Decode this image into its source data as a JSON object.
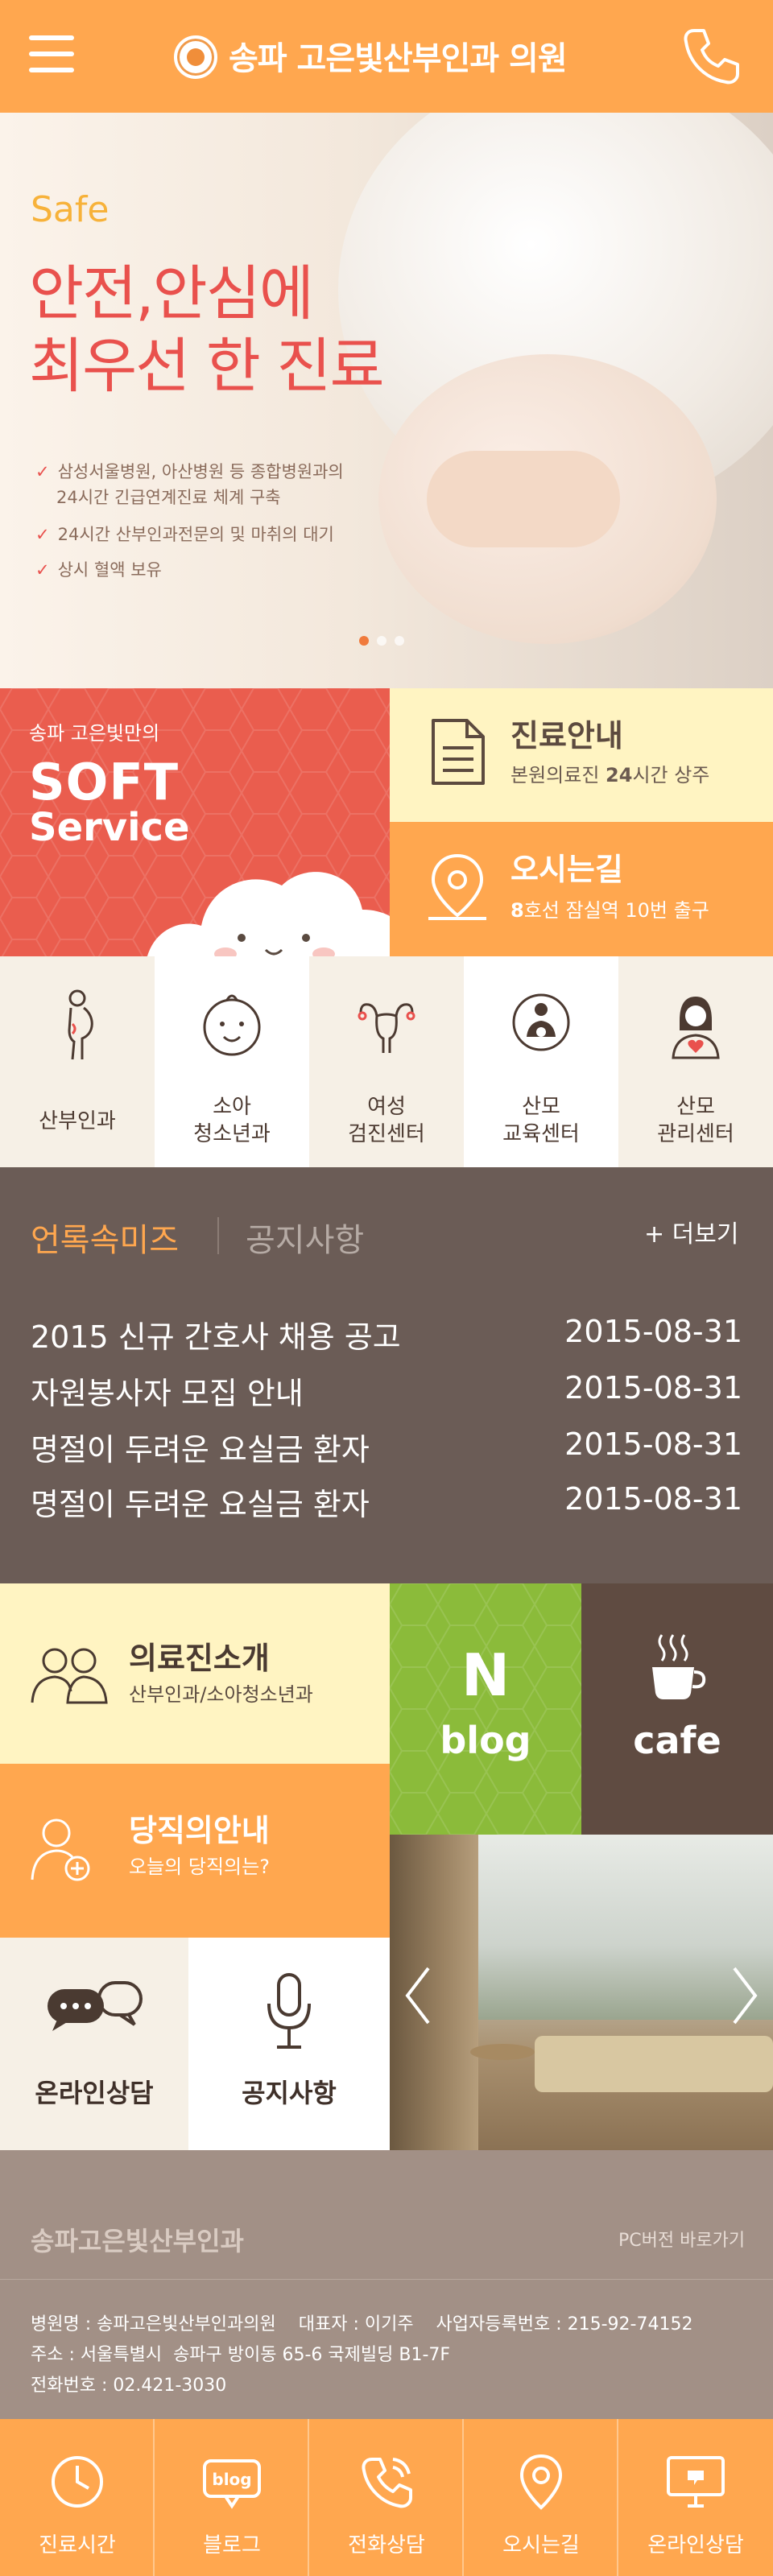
{
  "header": {
    "title": "송파 고은빛산부인과 의원",
    "menu_icon": "hamburger-icon",
    "phone_icon": "phone-icon",
    "logo_icon": "hospital-emblem",
    "brand_color": "#ffa74f"
  },
  "hero": {
    "eyebrow": "Safe",
    "title_line1": "안전,안심에",
    "title_line2": "최우선 한 진료",
    "points": [
      "삼성서울병원, 아산병원 등 종합병원과의",
      "24시간 긴급연계진료 체계 구축",
      "24시간 산부인과전문의 및 마취의 대기",
      "상시 혈액 보유"
    ],
    "slide_count": 3,
    "active_slide": 1,
    "accent": "#e9514d"
  },
  "soft_service": {
    "pre": "송파 고은빛만의",
    "line1": "SOFT",
    "line2": "Service",
    "color": "#ea5d4e"
  },
  "care_info": {
    "title": "진료안내",
    "sub_prefix": "본원의료진 ",
    "sub_bold": "24",
    "sub_suffix": "시간 상주",
    "icon": "document-icon"
  },
  "directions": {
    "title": "오시는길",
    "sub_bold": "8",
    "sub_suffix": "호선 잠실역 10번 출구",
    "icon": "location-pin-icon"
  },
  "centers": [
    {
      "label": "산부인과",
      "icon": "pregnant-woman-icon",
      "bg": "#f6f0e6"
    },
    {
      "label": "소아\n청소년과",
      "icon": "baby-face-icon",
      "bg": "#ffffff"
    },
    {
      "label": "여성\n검진센터",
      "icon": "uterus-icon",
      "bg": "#f6f0e6"
    },
    {
      "label": "산모\n교육센터",
      "icon": "mother-child-icon",
      "bg": "#ffffff"
    },
    {
      "label": "산모\n관리센터",
      "icon": "mother-heart-icon",
      "bg": "#f6f0e6"
    }
  ],
  "notice": {
    "tab_active": "언록속미즈",
    "tab_inactive": "공지사항",
    "more": "+ 더보기",
    "items": [
      {
        "title": "2015 신규 간호사 채용 공고",
        "date": "2015-08-31"
      },
      {
        "title": "자원봉사자 모집 안내",
        "date": "2015-08-31"
      },
      {
        "title": "명절이 두려운 요실금 환자",
        "date": "2015-08-31"
      },
      {
        "title": "명절이 두려운 요실금 환자",
        "date": "2015-08-31"
      }
    ]
  },
  "promos": {
    "doctors": {
      "title": "의료진소개",
      "sub": "산부인과/소아청소년과",
      "icon": "doctors-icon"
    },
    "duty": {
      "title": "당직의안내",
      "sub": "오늘의 당직의는?",
      "icon": "add-user-icon"
    },
    "blog": {
      "logo": "N",
      "label": "blog"
    },
    "cafe": {
      "label": "cafe",
      "icon": "coffee-cup-icon"
    },
    "online": {
      "label": "온라인상담",
      "icon": "chat-bubbles-icon"
    },
    "notice": {
      "label": "공지사항",
      "icon": "microphone-icon"
    },
    "gallery": {
      "prev_icon": "chevron-left-icon",
      "next_icon": "chevron-right-icon"
    }
  },
  "footer": {
    "brand": "송파고은빛산부인과",
    "pc_link": "PC버전 바로가기",
    "line1": "병원명 : 송파고은빛산부인과의원    대표자 : 이기주    사업자등록번호 : 215-92-74152",
    "line2": "주소 : 서울특별시  송파구 방이동 65-6 국제빌딩 B1-7F",
    "line3": "전화번호 : 02.421-3030"
  },
  "bottom_nav": [
    {
      "label": "진료시간",
      "icon": "clock-icon"
    },
    {
      "label": "블로그",
      "icon": "blog-icon"
    },
    {
      "label": "전화상담",
      "icon": "phone-icon"
    },
    {
      "label": "오시는길",
      "icon": "location-pin-icon"
    },
    {
      "label": "온라인상담",
      "icon": "monitor-chat-icon"
    }
  ]
}
